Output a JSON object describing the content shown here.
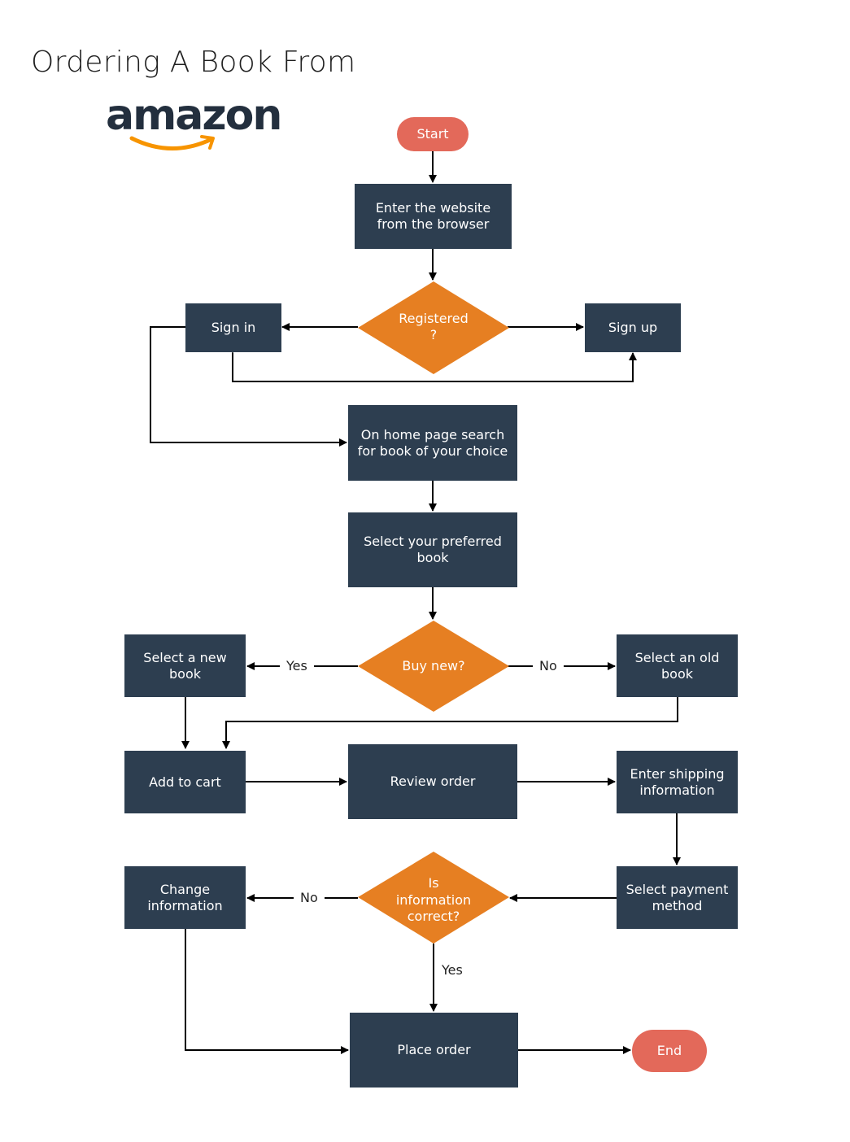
{
  "title": "Ordering A Book From",
  "logo": {
    "text": "amazon",
    "text_color": "#232f3e",
    "smile_color": "#f79400"
  },
  "colors": {
    "process": "#2d3e50",
    "decision": "#e67f22",
    "terminal": "#e3695a",
    "connector": "#000000"
  },
  "nodes": {
    "start": "Start",
    "enter_website": "Enter the website from the browser",
    "registered": [
      "Registered",
      "?"
    ],
    "sign_in": "Sign in",
    "sign_up": "Sign up",
    "search": "On home page search for book of your choice",
    "select_book": "Select your preferred book",
    "buy_new": "Buy new?",
    "select_new": "Select a new book",
    "select_old": "Select an old book",
    "add_to_cart": "Add to cart",
    "review_order": "Review order",
    "shipping": "Enter shipping information",
    "payment": "Select payment method",
    "info_correct": [
      "Is",
      "information",
      "correct?"
    ],
    "change_info": "Change information",
    "place_order": "Place order",
    "end": "End"
  },
  "edge_labels": {
    "buy_new_yes": "Yes",
    "buy_new_no": "No",
    "info_no": "No",
    "info_yes": "Yes"
  }
}
